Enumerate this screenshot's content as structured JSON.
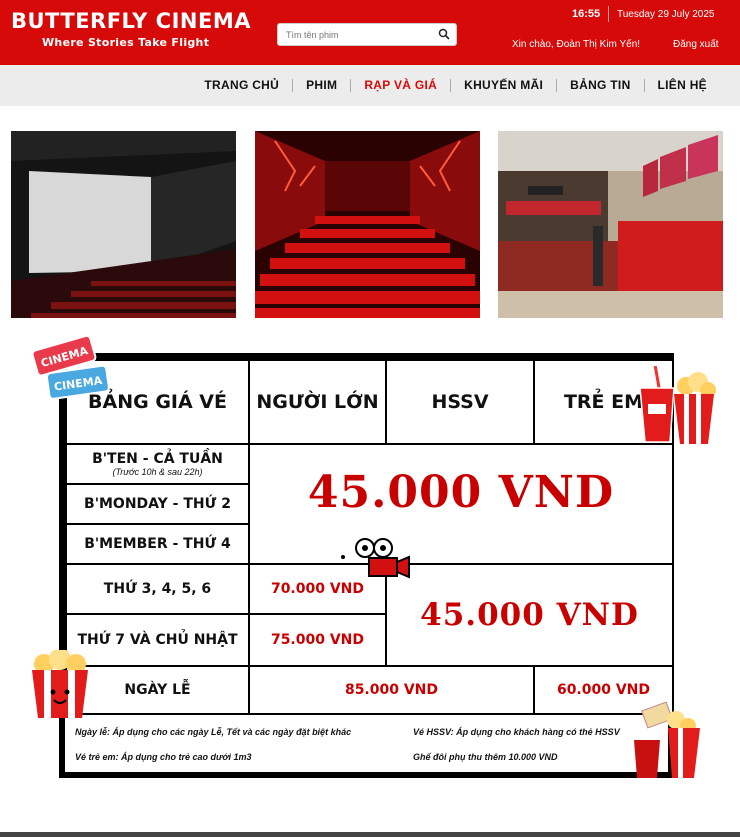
{
  "header": {
    "brand_name": "BUTTERFLY CINEMA",
    "brand_tagline": "Where Stories Take Flight",
    "search_placeholder": "Tìm tên phim",
    "time": "16:55",
    "date": "Tuesday 29 July 2025",
    "greeting": "Xin chào, Đoàn Thị Kim Yến!",
    "logout_label": "Đăng xuất",
    "brand_color": "#d70a0a"
  },
  "nav": {
    "items": [
      {
        "label": "TRANG CHỦ",
        "active": false
      },
      {
        "label": "PHIM",
        "active": false
      },
      {
        "label": "RẠP VÀ GIÁ",
        "active": true
      },
      {
        "label": "KHUYẾN MÃI",
        "active": false
      },
      {
        "label": "BẢNG TIN",
        "active": false
      },
      {
        "label": "LIÊN HỆ",
        "active": false
      }
    ]
  },
  "photos": [
    {
      "icon": "cinema-screen-hall-photo"
    },
    {
      "icon": "red-seats-theater-photo"
    },
    {
      "icon": "ticket-box-lobby-photo"
    }
  ],
  "price_board": {
    "headers": {
      "title": "BẢNG GIÁ VÉ",
      "adult": "NGƯỜI LỚN",
      "student": "HSSV",
      "child": "TRẺ EM"
    },
    "rows": {
      "bten": "B'TEN - CẢ TUẦN",
      "bten_note": "(Trước 10h & sau 22h)",
      "bmonday": "B'MONDAY - THỨ 2",
      "bmember": "B'MEMBER - THỨ 4",
      "weekday": "THỨ 3, 4, 5, 6",
      "weekend": "THỨ 7 VÀ CHỦ NHẬT",
      "holiday": "NGÀY LỄ"
    },
    "prices": {
      "promo_all": "45.000 VND",
      "weekday_adult": "70.000 VND",
      "weekend_adult": "75.000 VND",
      "weekday_weekend_other": "45.000 VND",
      "holiday_adult_student": "85.000 VND",
      "holiday_child": "60.000 VND"
    },
    "notes": {
      "holiday": "Ngày lễ: Áp dụng cho các ngày Lễ, Tết và các ngày đặt biệt khác",
      "student": "Vé HSSV: Áp dụng cho khách hàng có thẻ HSSV",
      "child": "Vé trẻ em: Áp dụng cho trẻ cao dưới 1m3",
      "couple": "Ghế đôi phụ thu thêm 10.000 VND"
    },
    "stickers": {
      "cinema_ticket_1": "CINEMA",
      "cinema_ticket_2": "CINEMA",
      "icons": [
        "cinema-ticket-icon",
        "popcorn-soda-icon",
        "film-camera-icon",
        "popcorn-face-icon",
        "popcorn-tickets-icon"
      ]
    },
    "price_color": "#c80000"
  }
}
